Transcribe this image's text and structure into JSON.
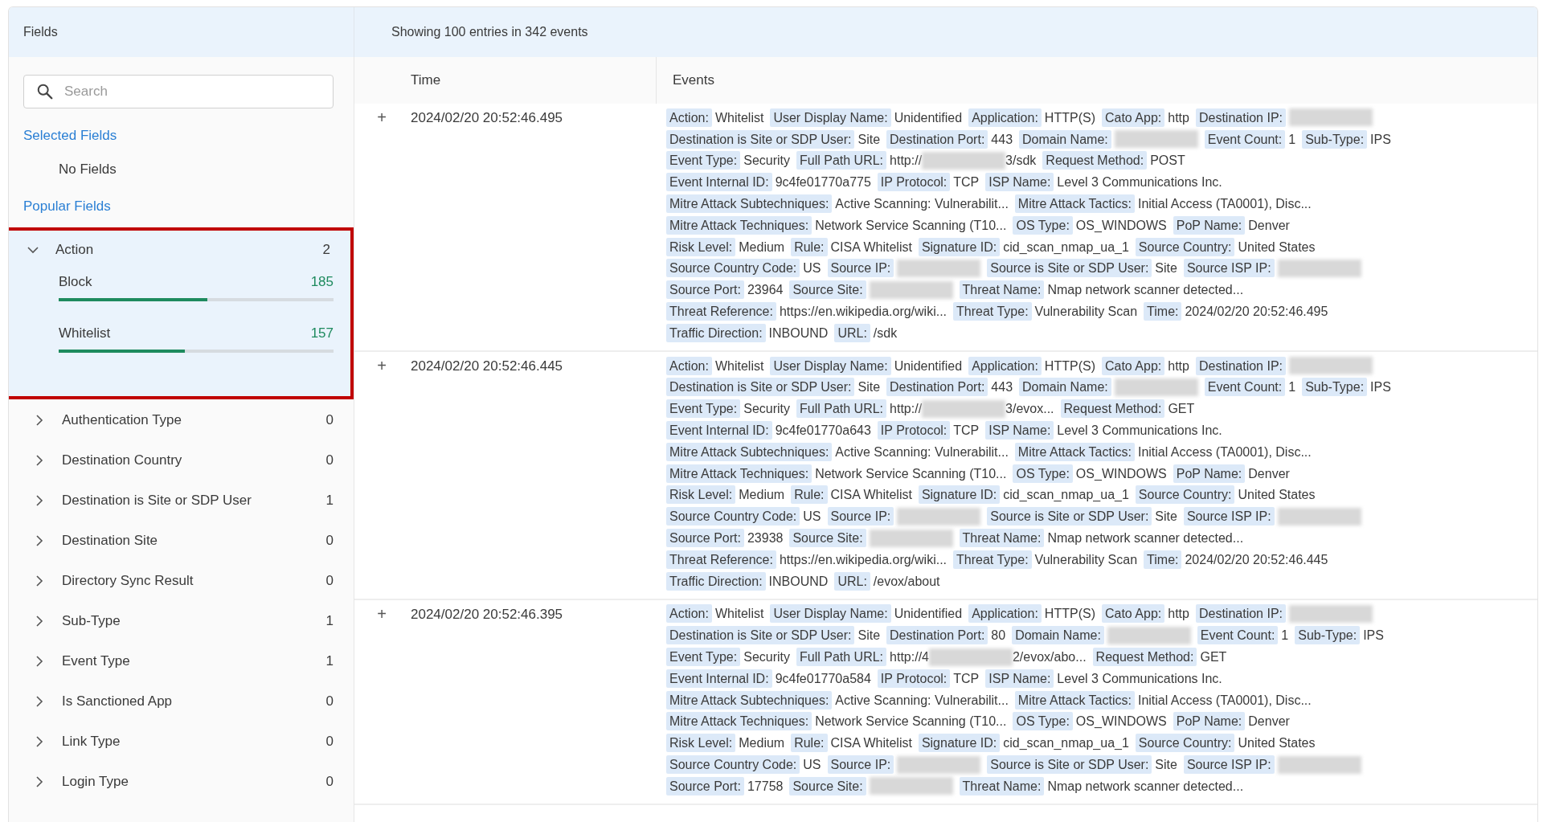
{
  "header": {
    "panel_title": "Fields",
    "summary": "Showing 100 entries in 342 events"
  },
  "search": {
    "placeholder": "Search"
  },
  "selected_fields": {
    "title": "Selected Fields",
    "empty_text": "No Fields"
  },
  "popular_fields": {
    "title": "Popular Fields",
    "items": [
      {
        "label": "Action",
        "count": "2",
        "expanded": true,
        "highlighted": true,
        "values": [
          {
            "label": "Block",
            "count": "185",
            "level": 0.54
          },
          {
            "label": "Whitelist",
            "count": "157",
            "level": 0.46
          }
        ]
      },
      {
        "label": "Authentication Type",
        "count": "0",
        "expanded": false,
        "highlighted": false
      },
      {
        "label": "Destination Country",
        "count": "0",
        "expanded": false,
        "highlighted": false
      },
      {
        "label": "Destination is Site or SDP User",
        "count": "1",
        "expanded": false,
        "highlighted": false
      },
      {
        "label": "Destination Site",
        "count": "0",
        "expanded": false,
        "highlighted": false
      },
      {
        "label": "Directory Sync Result",
        "count": "0",
        "expanded": false,
        "highlighted": false
      },
      {
        "label": "Sub-Type",
        "count": "1",
        "expanded": false,
        "highlighted": false
      },
      {
        "label": "Event Type",
        "count": "1",
        "expanded": false,
        "highlighted": false
      },
      {
        "label": "Is Sanctioned App",
        "count": "0",
        "expanded": false,
        "highlighted": false
      },
      {
        "label": "Link Type",
        "count": "0",
        "expanded": false,
        "highlighted": false
      },
      {
        "label": "Login Type",
        "count": "0",
        "expanded": false,
        "highlighted": false
      }
    ]
  },
  "table": {
    "columns": [
      "Time",
      "Events"
    ],
    "rows": [
      {
        "expand": "+",
        "time": "2024/02/20 20:52:46.495",
        "lines": [
          [
            {
              "key": "Action:",
              "value": "Whitelist"
            },
            {
              "key": "User Display Name:",
              "value": "Unidentified"
            },
            {
              "key": "Application:",
              "value": "HTTP(S)"
            },
            {
              "key": "Cato App:",
              "value": "http"
            },
            {
              "key": "Destination IP:",
              "redacted": true
            }
          ],
          [
            {
              "key": "Destination is Site or SDP User:",
              "value": "Site"
            },
            {
              "key": "Destination Port:",
              "value": "443"
            },
            {
              "key": "Domain Name:",
              "redacted": true
            },
            {
              "key": "Event Count:",
              "value": "1"
            },
            {
              "key": "Sub-Type:",
              "value": "IPS"
            }
          ],
          [
            {
              "key": "Event Type:",
              "value": "Security"
            },
            {
              "key": "Full Path URL:",
              "value": "http://",
              "redacted": true,
              "value_after": "3/sdk"
            },
            {
              "key": "Request Method:",
              "value": "POST"
            }
          ],
          [
            {
              "key": "Event Internal ID:",
              "value": "9c4fe01770a775"
            },
            {
              "key": "IP Protocol:",
              "value": "TCP"
            },
            {
              "key": "ISP Name:",
              "value": "Level 3 Communications Inc."
            }
          ],
          [
            {
              "key": "Mitre Attack Subtechniques:",
              "value": "Active Scanning: Vulnerabilit..."
            },
            {
              "key": "Mitre Attack Tactics:",
              "value": "Initial Access (TA0001), Disc..."
            }
          ],
          [
            {
              "key": "Mitre Attack Techniques:",
              "value": "Network Service Scanning (T10..."
            },
            {
              "key": "OS Type:",
              "value": "OS_WINDOWS"
            },
            {
              "key": "PoP Name:",
              "value": "Denver"
            }
          ],
          [
            {
              "key": "Risk Level:",
              "value": "Medium"
            },
            {
              "key": "Rule:",
              "value": "CISA Whitelist"
            },
            {
              "key": "Signature ID:",
              "value": "cid_scan_nmap_ua_1"
            },
            {
              "key": "Source Country:",
              "value": "United States"
            }
          ],
          [
            {
              "key": "Source Country Code:",
              "value": "US"
            },
            {
              "key": "Source IP:",
              "redacted": true
            },
            {
              "key": "Source is Site or SDP User:",
              "value": "Site"
            },
            {
              "key": "Source ISP IP:",
              "redacted": true
            }
          ],
          [
            {
              "key": "Source Port:",
              "value": "23964"
            },
            {
              "key": "Source Site:",
              "redacted": true
            },
            {
              "key": "Threat Name:",
              "value": "Nmap network scanner detected..."
            }
          ],
          [
            {
              "key": "Threat Reference:",
              "value": "https://en.wikipedia.org/wiki..."
            },
            {
              "key": "Threat Type:",
              "value": "Vulnerability Scan"
            },
            {
              "key": "Time:",
              "value": "2024/02/20 20:52:46.495"
            }
          ],
          [
            {
              "key": "Traffic Direction:",
              "value": "INBOUND"
            },
            {
              "key": "URL:",
              "value": "/sdk"
            }
          ]
        ]
      },
      {
        "expand": "+",
        "time": "2024/02/20 20:52:46.445",
        "lines": [
          [
            {
              "key": "Action:",
              "value": "Whitelist"
            },
            {
              "key": "User Display Name:",
              "value": "Unidentified"
            },
            {
              "key": "Application:",
              "value": "HTTP(S)"
            },
            {
              "key": "Cato App:",
              "value": "http"
            },
            {
              "key": "Destination IP:",
              "redacted": true
            }
          ],
          [
            {
              "key": "Destination is Site or SDP User:",
              "value": "Site"
            },
            {
              "key": "Destination Port:",
              "value": "443"
            },
            {
              "key": "Domain Name:",
              "redacted": true
            },
            {
              "key": "Event Count:",
              "value": "1"
            },
            {
              "key": "Sub-Type:",
              "value": "IPS"
            }
          ],
          [
            {
              "key": "Event Type:",
              "value": "Security"
            },
            {
              "key": "Full Path URL:",
              "value": "http://",
              "redacted": true,
              "value_after": "3/evox..."
            },
            {
              "key": "Request Method:",
              "value": "GET"
            }
          ],
          [
            {
              "key": "Event Internal ID:",
              "value": "9c4fe01770a643"
            },
            {
              "key": "IP Protocol:",
              "value": "TCP"
            },
            {
              "key": "ISP Name:",
              "value": "Level 3 Communications Inc."
            }
          ],
          [
            {
              "key": "Mitre Attack Subtechniques:",
              "value": "Active Scanning: Vulnerabilit..."
            },
            {
              "key": "Mitre Attack Tactics:",
              "value": "Initial Access (TA0001), Disc..."
            }
          ],
          [
            {
              "key": "Mitre Attack Techniques:",
              "value": "Network Service Scanning (T10..."
            },
            {
              "key": "OS Type:",
              "value": "OS_WINDOWS"
            },
            {
              "key": "PoP Name:",
              "value": "Denver"
            }
          ],
          [
            {
              "key": "Risk Level:",
              "value": "Medium"
            },
            {
              "key": "Rule:",
              "value": "CISA Whitelist"
            },
            {
              "key": "Signature ID:",
              "value": "cid_scan_nmap_ua_1"
            },
            {
              "key": "Source Country:",
              "value": "United States"
            }
          ],
          [
            {
              "key": "Source Country Code:",
              "value": "US"
            },
            {
              "key": "Source IP:",
              "redacted": true
            },
            {
              "key": "Source is Site or SDP User:",
              "value": "Site"
            },
            {
              "key": "Source ISP IP:",
              "redacted": true
            }
          ],
          [
            {
              "key": "Source Port:",
              "value": "23938"
            },
            {
              "key": "Source Site:",
              "redacted": true
            },
            {
              "key": "Threat Name:",
              "value": "Nmap network scanner detected..."
            }
          ],
          [
            {
              "key": "Threat Reference:",
              "value": "https://en.wikipedia.org/wiki..."
            },
            {
              "key": "Threat Type:",
              "value": "Vulnerability Scan"
            },
            {
              "key": "Time:",
              "value": "2024/02/20 20:52:46.445"
            }
          ],
          [
            {
              "key": "Traffic Direction:",
              "value": "INBOUND"
            },
            {
              "key": "URL:",
              "value": "/evox/about"
            }
          ]
        ]
      },
      {
        "expand": "+",
        "time": "2024/02/20 20:52:46.395",
        "lines": [
          [
            {
              "key": "Action:",
              "value": "Whitelist"
            },
            {
              "key": "User Display Name:",
              "value": "Unidentified"
            },
            {
              "key": "Application:",
              "value": "HTTP(S)"
            },
            {
              "key": "Cato App:",
              "value": "http"
            },
            {
              "key": "Destination IP:",
              "redacted": true
            }
          ],
          [
            {
              "key": "Destination is Site or SDP User:",
              "value": "Site"
            },
            {
              "key": "Destination Port:",
              "value": "80"
            },
            {
              "key": "Domain Name:",
              "redacted": true
            },
            {
              "key": "Event Count:",
              "value": "1"
            },
            {
              "key": "Sub-Type:",
              "value": "IPS"
            }
          ],
          [
            {
              "key": "Event Type:",
              "value": "Security"
            },
            {
              "key": "Full Path URL:",
              "value": "http://4",
              "redacted": true,
              "value_after": "2/evox/abo..."
            },
            {
              "key": "Request Method:",
              "value": "GET"
            }
          ],
          [
            {
              "key": "Event Internal ID:",
              "value": "9c4fe01770a584"
            },
            {
              "key": "IP Protocol:",
              "value": "TCP"
            },
            {
              "key": "ISP Name:",
              "value": "Level 3 Communications Inc."
            }
          ],
          [
            {
              "key": "Mitre Attack Subtechniques:",
              "value": "Active Scanning: Vulnerabilit..."
            },
            {
              "key": "Mitre Attack Tactics:",
              "value": "Initial Access (TA0001), Disc..."
            }
          ],
          [
            {
              "key": "Mitre Attack Techniques:",
              "value": "Network Service Scanning (T10..."
            },
            {
              "key": "OS Type:",
              "value": "OS_WINDOWS"
            },
            {
              "key": "PoP Name:",
              "value": "Denver"
            }
          ],
          [
            {
              "key": "Risk Level:",
              "value": "Medium"
            },
            {
              "key": "Rule:",
              "value": "CISA Whitelist"
            },
            {
              "key": "Signature ID:",
              "value": "cid_scan_nmap_ua_1"
            },
            {
              "key": "Source Country:",
              "value": "United States"
            }
          ],
          [
            {
              "key": "Source Country Code:",
              "value": "US"
            },
            {
              "key": "Source IP:",
              "redacted": true
            },
            {
              "key": "Source is Site or SDP User:",
              "value": "Site"
            },
            {
              "key": "Source ISP IP:",
              "redacted": true
            }
          ],
          [
            {
              "key": "Source Port:",
              "value": "17758"
            },
            {
              "key": "Source Site:",
              "redacted": true
            },
            {
              "key": "Threat Name:",
              "value": "Nmap network scanner detected..."
            }
          ]
        ]
      }
    ]
  }
}
